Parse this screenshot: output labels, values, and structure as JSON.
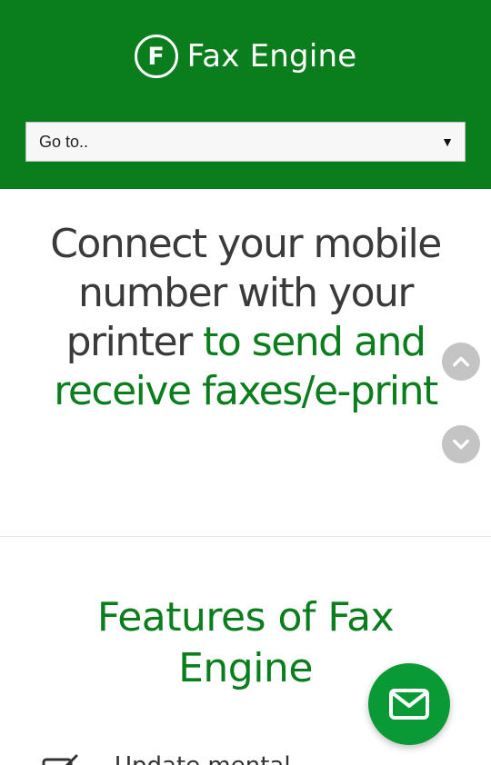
{
  "brand": {
    "logo_letter": "F",
    "name": "Fax Engine"
  },
  "nav_select": {
    "label": "Go to..",
    "arrow": "▼"
  },
  "hero": {
    "line1": "Connect your mobile",
    "line2": "number with your",
    "line3_plain": "printer ",
    "line3_green": "to send and",
    "line4_green": "receive faxes/e-print"
  },
  "features": {
    "title": "Features of Fax Engine",
    "first_item": "Update mental"
  },
  "icons": {
    "scroll_up": "chevron-up-icon",
    "scroll_down": "chevron-down-icon",
    "contact": "envelope-icon",
    "feature": "edit-icon"
  },
  "colors": {
    "brand_green": "#0a7d1c",
    "fab_green": "#0a9a35",
    "nav_button_gray": "#c4c4c4"
  }
}
